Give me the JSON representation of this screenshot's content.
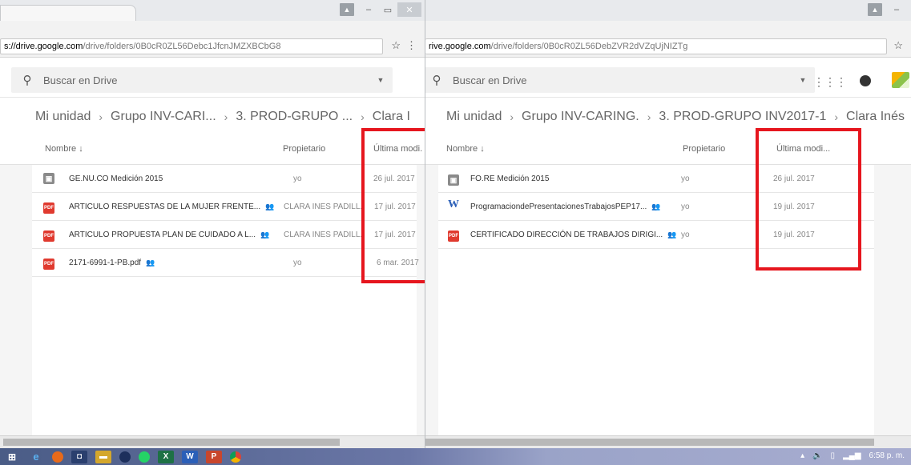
{
  "colors": {
    "highlight": "#e6161e",
    "pdf": "#e03a2f",
    "folder": "#8a8a8a",
    "word": "#2b5fb8"
  },
  "left_window": {
    "url_host": "s://drive.google.com",
    "url_path": "/drive/folders/0B0cR0ZL56Debc1JfcnJMZXBCbG8",
    "search_placeholder": "Buscar en Drive",
    "breadcrumb": [
      "Mi unidad",
      "Grupo INV-CARI...",
      "3. PROD-GRUPO ...",
      "Clara I"
    ],
    "columns": {
      "name": "Nombre",
      "owner": "Propietario",
      "modified": "Última modi."
    },
    "files": [
      {
        "icon": "folder-icon",
        "name": "GE.NU.CO Medición 2015",
        "shared": false,
        "owner": "yo",
        "modified": "26 jul. 2017"
      },
      {
        "icon": "pdf-icon",
        "name": "ARTICULO RESPUESTAS DE LA MUJER FRENTE...",
        "shared": true,
        "owner": "CLARA INES PADILL.",
        "modified": "17 jul. 2017"
      },
      {
        "icon": "pdf-icon",
        "name": "ARTICULO PROPUESTA PLAN DE CUIDADO A L...",
        "shared": true,
        "owner": "CLARA INES PADILL.",
        "modified": "17 jul. 2017"
      },
      {
        "icon": "pdf-icon",
        "name": "2171-6991-1-PB.pdf",
        "shared": true,
        "owner": "yo",
        "modified": "6 mar. 2017"
      }
    ]
  },
  "right_window": {
    "url_host": "rive.google.com",
    "url_path": "/drive/folders/0B0cR0ZL56DebZVR2dVZqUjNIZTg",
    "search_placeholder": "Buscar en Drive",
    "breadcrumb": [
      "Mi unidad",
      "Grupo INV-CARING.",
      "3. PROD-GRUPO INV2017-1",
      "Clara Inés"
    ],
    "columns": {
      "name": "Nombre",
      "owner": "Propietario",
      "modified": "Última modi..."
    },
    "files": [
      {
        "icon": "folder-icon",
        "name": "FO.RE Medición 2015",
        "shared": false,
        "owner": "yo",
        "modified": "26 jul. 2017"
      },
      {
        "icon": "word-icon",
        "name": "ProgramaciondePresentacionesTrabajosPEP17...",
        "shared": true,
        "owner": "yo",
        "modified": "19 jul. 2017"
      },
      {
        "icon": "pdf-icon",
        "name": "CERTIFICADO DIRECCIÓN DE TRABAJOS DIRIGI...",
        "shared": true,
        "owner": "yo",
        "modified": "19 jul. 2017"
      }
    ]
  },
  "icon_glyphs": {
    "pdf": "PDF",
    "word": "W",
    "folder": "▣",
    "shared": "👥",
    "sort": "↓",
    "sep": "›",
    "star": "☆"
  },
  "taskbar": {
    "icons": [
      "windows-start-icon",
      "ie-icon",
      "firefox-icon",
      "store-icon",
      "file-explorer-icon",
      "media-icon",
      "whatsapp-icon",
      "excel-icon",
      "word-icon",
      "powerpoint-icon",
      "chrome-icon"
    ],
    "excel_glyph": "X",
    "word_glyph": "W",
    "ppt_glyph": "P",
    "clock": "6:58 p. m."
  }
}
